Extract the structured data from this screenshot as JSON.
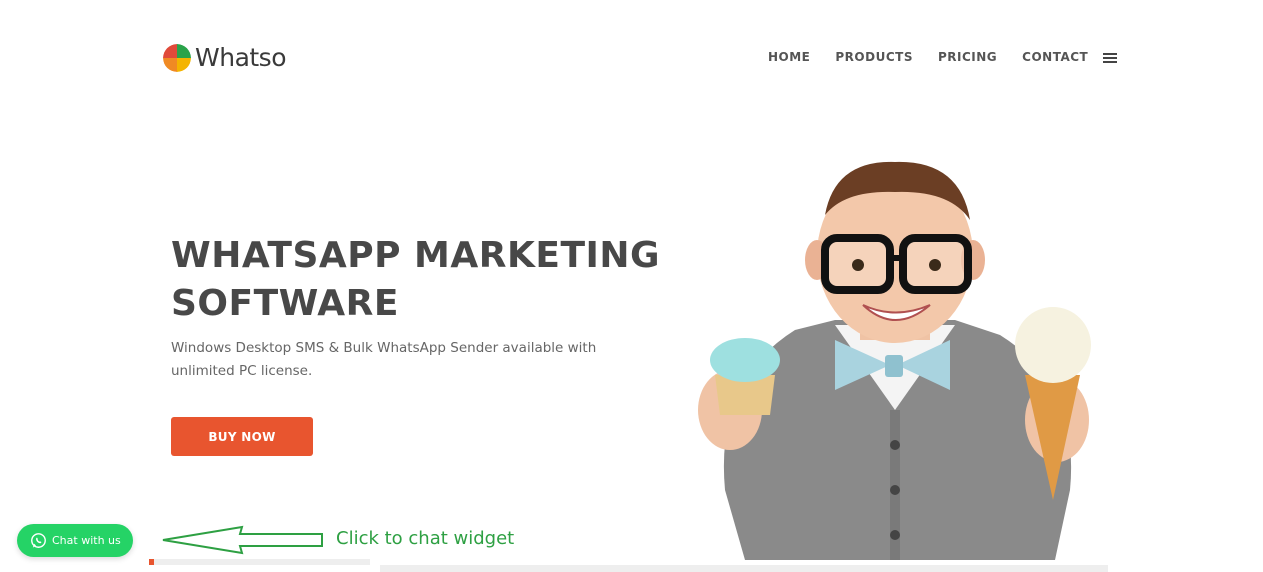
{
  "header": {
    "logo_text": "Whatso",
    "nav": [
      {
        "label": "HOME"
      },
      {
        "label": "PRODUCTS"
      },
      {
        "label": "PRICING"
      },
      {
        "label": "CONTACT"
      }
    ],
    "menu_icon": "hamburger-menu-icon"
  },
  "hero": {
    "title_line1": "WHATSAPP MARKETING",
    "title_line2": "SOFTWARE",
    "subtitle": "Windows Desktop SMS & Bulk WhatsApp Sender available with unlimited PC license.",
    "cta_label": "BUY NOW",
    "image": "kid-with-glasses-holding-cupcake-and-ice-cream"
  },
  "chat_widget": {
    "label": "Chat with us",
    "icon": "whatsapp-icon"
  },
  "annotation": {
    "text": "Click to chat widget",
    "icon": "arrow-left-icon"
  },
  "colors": {
    "accent": "#e8552f",
    "whatsapp_green": "#25d366",
    "annotation_green": "#2ea043",
    "text_dark": "#484848"
  }
}
